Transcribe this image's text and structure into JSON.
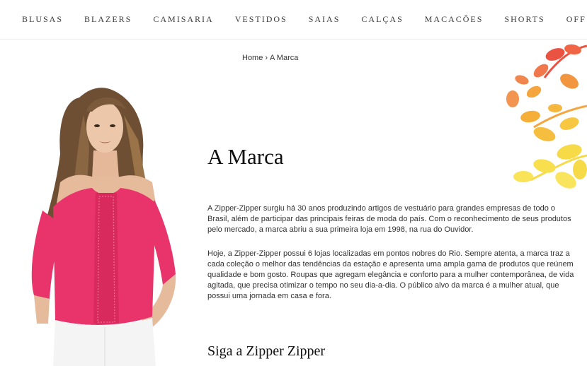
{
  "nav": {
    "items": [
      {
        "label": "BLUSAS"
      },
      {
        "label": "BLAZERS"
      },
      {
        "label": "CAMISARIA"
      },
      {
        "label": "VESTIDOS"
      },
      {
        "label": "SAIAS"
      },
      {
        "label": "CALÇAS"
      },
      {
        "label": "MACACÕES"
      },
      {
        "label": "SHORTS"
      },
      {
        "label": "OFF"
      }
    ]
  },
  "breadcrumb": {
    "home": "Home",
    "separator": "›",
    "current": "A Marca"
  },
  "main": {
    "title": "A Marca",
    "paragraphs": [
      "A Zipper-Zipper surgiu há 30 anos produzindo artigos de vestuário para grandes empresas de todo o Brasil, além de participar das principais feiras de moda do país. Com o reconhecimento de seus produtos pelo mercado, a marca abriu a sua primeira loja em 1998, na rua do Ouvidor.",
      "Hoje, a Zipper-Zipper possui 6 lojas localizadas em pontos nobres do Rio. Sempre atenta, a marca traz a cada coleção o melhor das tendências da estação e apresenta uma ampla gama de produtos que reúnem qualidade e bom gosto. Roupas que agregam elegância e conforto para a mulher contemporânea, de vida agitada, que precisa otimizar o tempo no seu dia-a-dia. O público alvo da marca é a mulher atual, que possui uma jornada em casa e fora."
    ],
    "section_heading": "Siga a Zipper Zipper"
  },
  "colors": {
    "blouse": "#e8336b",
    "hair": "#7a5a3a",
    "skin": "#e9c4a6",
    "flower_red": "#e8402e",
    "flower_orange": "#f39c2a",
    "flower_yellow": "#f6d634"
  }
}
